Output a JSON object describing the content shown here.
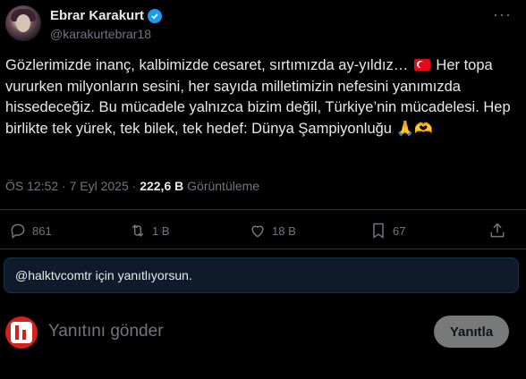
{
  "author": {
    "name": "Ebrar Karakurt",
    "handle": "@karakurtebrar18"
  },
  "tweet": {
    "text_1": "Gözlerimizde inanç, kalbimizde cesaret, sırtımızda ay-yıldız…",
    "text_2": "Her topa vururken milyonların sesini, her sayıda milletimizin nefesini yanımızda hissedeceğiz. Bu mücadele yalnızca bizim değil, Türkiye’nin mücadelesi. Hep birlikte tek yürek, tek bilek, tek hedef: Dünya Şampiyonluğu",
    "emoji_end": "🙏🫶"
  },
  "meta": {
    "time": "ÖS 12:52 · 7 Eyl 2025 · ",
    "views_count": "222,6 B",
    "views_label": " Görüntüleme"
  },
  "actions": {
    "replies": "861",
    "reposts": "1 B",
    "likes": "18 B",
    "bookmarks": "67"
  },
  "reply_context": "@halktvcomtr için yanıtlıyorsun.",
  "composer": {
    "placeholder": "Yanıtını gönder",
    "submit_label": "Yanıtla"
  },
  "colors": {
    "background": "#000000",
    "verified": "#1d9bf0",
    "muted": "#71767b"
  },
  "icons": [
    "verified-badge-icon",
    "more-icon",
    "reply-icon",
    "repost-icon",
    "like-icon",
    "bookmark-icon",
    "share-icon",
    "turkish-flag-icon"
  ]
}
